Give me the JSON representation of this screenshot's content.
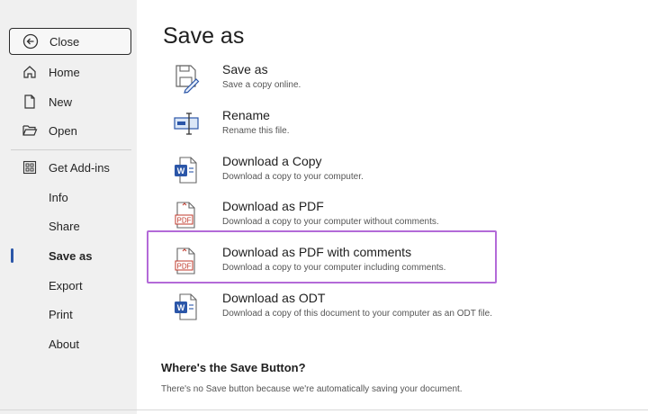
{
  "sidebar": {
    "close_label": "Close",
    "items": [
      {
        "label": "Home",
        "icon": "home-icon"
      },
      {
        "label": "New",
        "icon": "new-document-icon"
      },
      {
        "label": "Open",
        "icon": "folder-open-icon"
      },
      {
        "label": "Get Add-ins",
        "icon": "grid-icon"
      },
      {
        "label": "Info"
      },
      {
        "label": "Share"
      },
      {
        "label": "Save as",
        "selected": true
      },
      {
        "label": "Export"
      },
      {
        "label": "Print"
      },
      {
        "label": "About"
      }
    ]
  },
  "main": {
    "title": "Save as",
    "options": [
      {
        "title": "Save as",
        "description": "Save a copy online.",
        "icon": "save-as-icon"
      },
      {
        "title": "Rename",
        "description": "Rename this file.",
        "icon": "rename-icon"
      },
      {
        "title": "Download a Copy",
        "description": "Download a copy to your computer.",
        "icon": "word-document-icon"
      },
      {
        "title": "Download as PDF",
        "description": "Download a copy to your computer without comments.",
        "icon": "pdf-icon",
        "icon_text": "PDF"
      },
      {
        "title": "Download as PDF with comments",
        "description": "Download a copy to your computer including comments.",
        "icon": "pdf-icon",
        "icon_text": "PDF",
        "highlighted": true
      },
      {
        "title": "Download as ODT",
        "description": "Download a copy of this document to your computer as an ODT file.",
        "icon": "word-document-icon"
      }
    ],
    "info_title": "Where's the Save Button?",
    "info_text": "There's no Save button because we're automatically saving your document."
  },
  "colors": {
    "sidebar_bg": "#f0f0f0",
    "highlight_border": "#b36ad8",
    "word_blue": "#2b56a8",
    "pdf_red": "#c0392b"
  }
}
